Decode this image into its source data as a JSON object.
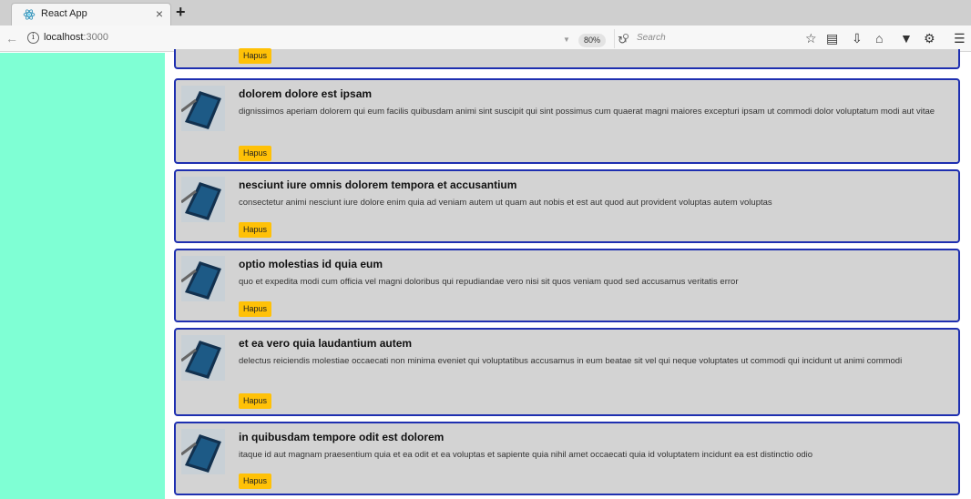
{
  "browser": {
    "tab_title": "React App",
    "tab_close": "×",
    "new_tab": "+",
    "url_host": "localhost",
    "url_port": ":3000",
    "zoom": "80%",
    "search_placeholder": "Search"
  },
  "colors": {
    "sidebar": "#7fffd4",
    "card_border": "#1e2fb0",
    "card_bg": "#d3d3d3",
    "button": "#ffc107"
  },
  "posts": [
    {
      "title": "",
      "body": "",
      "button": "Hapus"
    },
    {
      "title": "dolorem dolore est ipsam",
      "body": "dignissimos aperiam dolorem qui eum facilis quibusdam animi sint suscipit qui sint possimus cum quaerat magni maiores excepturi ipsam ut commodi dolor voluptatum modi aut vitae",
      "button": "Hapus"
    },
    {
      "title": "nesciunt iure omnis dolorem tempora et accusantium",
      "body": "consectetur animi nesciunt iure dolore enim quia ad veniam autem ut quam aut nobis et est aut quod aut provident voluptas autem voluptas",
      "button": "Hapus"
    },
    {
      "title": "optio molestias id quia eum",
      "body": "quo et expedita modi cum officia vel magni doloribus qui repudiandae vero nisi sit quos veniam quod sed accusamus veritatis error",
      "button": "Hapus"
    },
    {
      "title": "et ea vero quia laudantium autem",
      "body": "delectus reiciendis molestiae occaecati non minima eveniet qui voluptatibus accusamus in eum beatae sit vel qui neque voluptates ut commodi qui incidunt ut animi commodi",
      "button": "Hapus"
    },
    {
      "title": "in quibusdam tempore odit est dolorem",
      "body": "itaque id aut magnam praesentium quia et ea odit et ea voluptas et sapiente quia nihil amet occaecati quia id voluptatem incidunt ea est distinctio odio",
      "button": "Hapus"
    }
  ]
}
